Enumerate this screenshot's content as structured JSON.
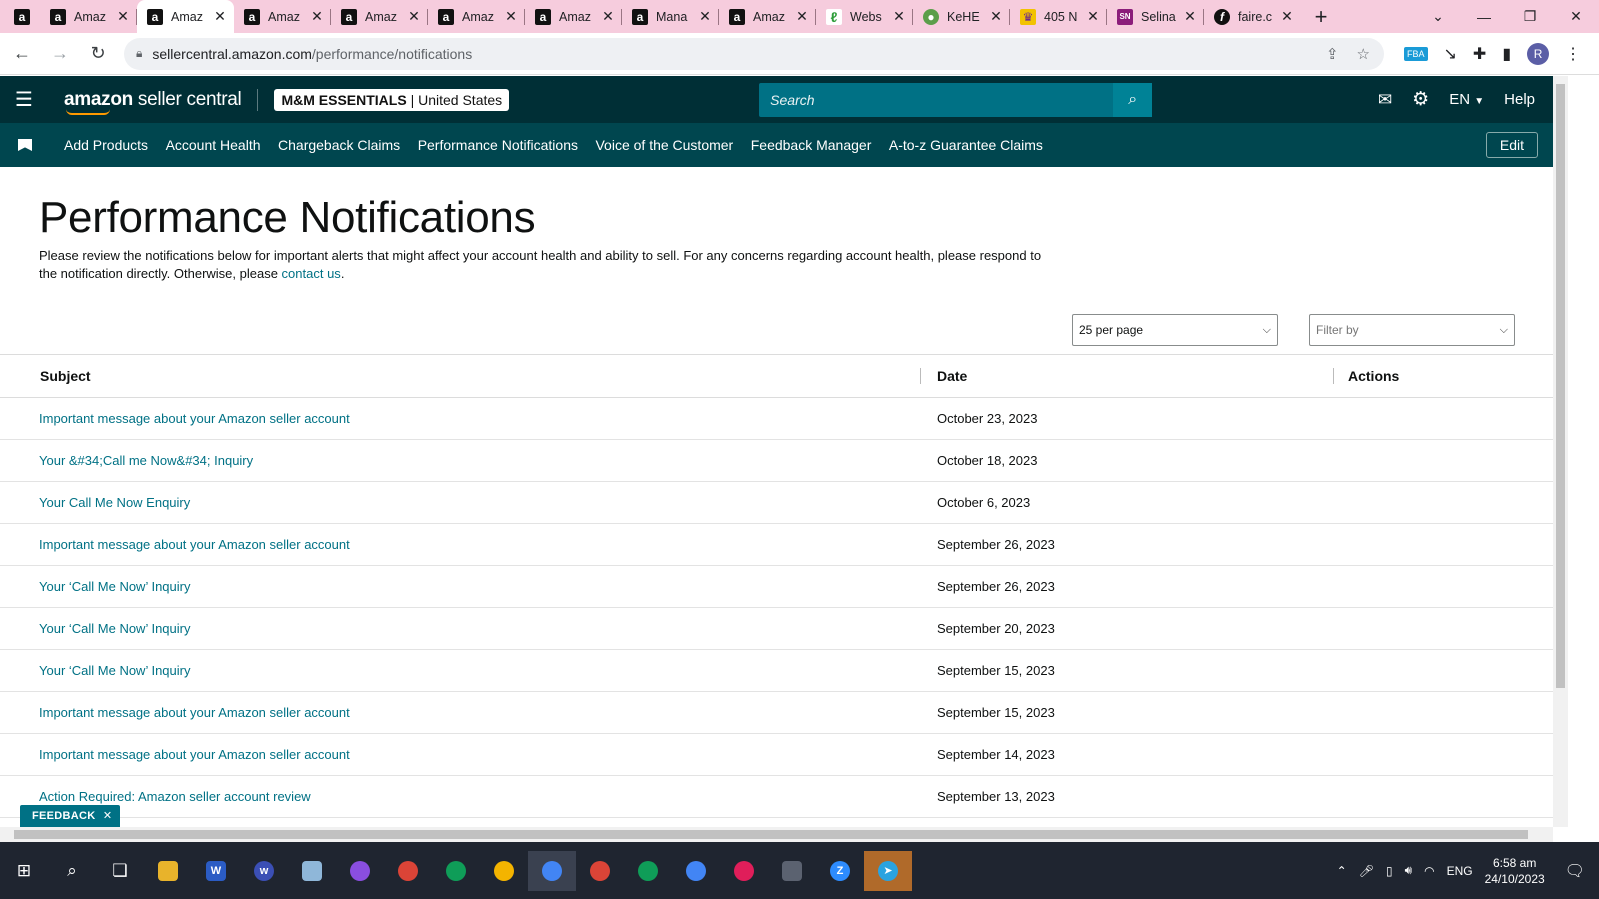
{
  "browser": {
    "tabs": [
      {
        "title": "",
        "favicon": "amazon-a",
        "active": false
      },
      {
        "title": "Amaz",
        "favicon": "amazon-a",
        "active": false
      },
      {
        "title": "Amaz",
        "favicon": "amazon-a",
        "active": true
      },
      {
        "title": "Amaz",
        "favicon": "amazon-a",
        "active": false
      },
      {
        "title": "Amaz",
        "favicon": "amazon-a",
        "active": false
      },
      {
        "title": "Amaz",
        "favicon": "amazon-a",
        "active": false
      },
      {
        "title": "Amaz",
        "favicon": "amazon-a",
        "active": false
      },
      {
        "title": "Mana",
        "favicon": "amazon-a",
        "active": false
      },
      {
        "title": "Amaz",
        "favicon": "amazon-a",
        "active": false
      },
      {
        "title": "Webs",
        "favicon": "leaf-icon",
        "active": false
      },
      {
        "title": "KeHE",
        "favicon": "globe-icon",
        "active": false
      },
      {
        "title": "405 N",
        "favicon": "yellow-icon",
        "active": false
      },
      {
        "title": "Selina",
        "favicon": "SN",
        "active": false
      },
      {
        "title": "faire.c",
        "favicon": "f",
        "active": false
      }
    ],
    "new_tab": "+",
    "url_host": "sellercentral.amazon.com",
    "url_path": "/performance/notifications",
    "profile_initial": "R"
  },
  "header": {
    "logo_bold": "amazon",
    "logo_rest": " seller central",
    "account_name": "M&M ESSENTIALS",
    "account_sep": " | ",
    "account_region": "United States",
    "search_placeholder": "Search",
    "language": "EN",
    "help": "Help"
  },
  "nav": {
    "items": [
      "Add Products",
      "Account Health",
      "Chargeback Claims",
      "Performance Notifications",
      "Voice of the Customer",
      "Feedback Manager",
      "A-to-z Guarantee Claims"
    ],
    "edit": "Edit"
  },
  "page": {
    "title": "Performance Notifications",
    "description": "Please review the notifications below for important alerts that might affect your account health and ability to sell. For any concerns regarding account health, please respond to the notification directly. Otherwise, please ",
    "contact_link": "contact us",
    "description_end": ".",
    "per_page": "25 per page",
    "filter_placeholder": "Filter by"
  },
  "table": {
    "headers": {
      "subject": "Subject",
      "date": "Date",
      "actions": "Actions"
    },
    "rows": [
      {
        "subject": "Important message about your Amazon seller account",
        "date": "October 23, 2023"
      },
      {
        "subject": "Your &#34;Call me Now&#34; Inquiry",
        "date": "October 18, 2023"
      },
      {
        "subject": "Your Call Me Now Enquiry",
        "date": "October 6, 2023"
      },
      {
        "subject": "Important message about your Amazon seller account",
        "date": "September 26, 2023"
      },
      {
        "subject": "Your ‘Call Me Now’ Inquiry",
        "date": "September 26, 2023"
      },
      {
        "subject": "Your ‘Call Me Now’ Inquiry",
        "date": "September 20, 2023"
      },
      {
        "subject": "Your ‘Call Me Now’ Inquiry",
        "date": "September 15, 2023"
      },
      {
        "subject": "Important message about your Amazon seller account",
        "date": "September 15, 2023"
      },
      {
        "subject": "Important message about your Amazon seller account",
        "date": "September 14, 2023"
      },
      {
        "subject": "Action Required: Amazon seller account review",
        "date": "September 13, 2023"
      }
    ]
  },
  "feedback_tab": "FEEDBACK",
  "taskbar": {
    "language": "ENG",
    "time": "6:58 am",
    "date": "24/10/2023"
  },
  "colors": {
    "header_bg": "#002f36",
    "nav_bg": "#00464f",
    "link": "#007185",
    "tabstrip_bg": "#f6ccdd"
  }
}
